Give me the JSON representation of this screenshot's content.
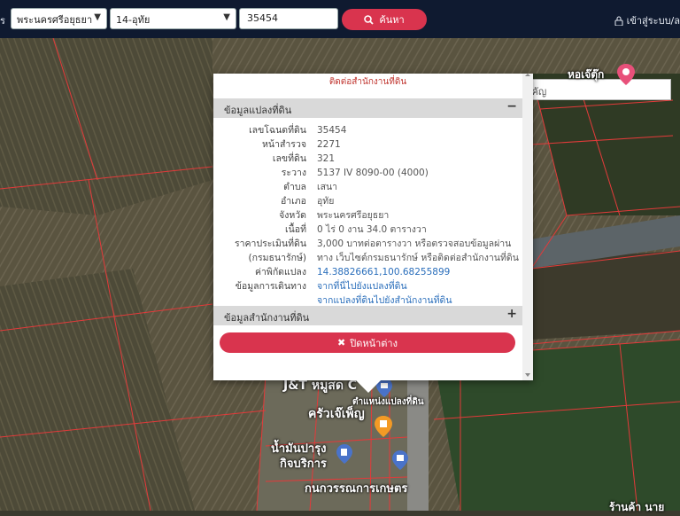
{
  "topbar": {
    "prov_label": "ร",
    "province": "พระนครศรีอยุธยา",
    "district": "14-อุทัย",
    "deed_no": "35454",
    "search_label": "ค้นหา",
    "login_label": "เข้าสู่ระบบ/ล"
  },
  "map": {
    "place_search_placeholder": "ค้นหาสถานที่สำคัญ",
    "labels": {
      "hor_jae_tuk": "หอเจ๊ตุ๊ก",
      "jt": "J&T หมูสด C",
      "parcel_pos": "ตำแหน่งแปลงที่ดิน",
      "krua": "ครัวเจ๊เพ็ญ",
      "oil1": "น้ำมันปารุง",
      "oil2": "กิจบริการ",
      "kanok": "กนกวรรณการเกษตร",
      "shop": "ร้านค้า นาย"
    }
  },
  "popup": {
    "top_link": "ติดต่อสำนักงานที่ดิน",
    "section1": "ข้อมูลแปลงที่ดิน",
    "section1_toggle": "−",
    "section2": "ข้อมูลสำนักงานที่ดิน",
    "section2_toggle": "+",
    "close_label": "ปิดหน้าต่าง",
    "rows": [
      {
        "k": "เลขโฉนดที่ดิน",
        "v": "35454"
      },
      {
        "k": "หน้าสำรวจ",
        "v": "2271"
      },
      {
        "k": "เลขที่ดิน",
        "v": "321"
      },
      {
        "k": "ระวาง",
        "v": "5137 IV 8090-00 (4000)"
      },
      {
        "k": "ตำบล",
        "v": "เสนา"
      },
      {
        "k": "อำเภอ",
        "v": "อุทัย"
      },
      {
        "k": "จังหวัด",
        "v": "พระนครศรีอยุธยา"
      },
      {
        "k": "เนื้อที่",
        "v": "0 ไร่ 0 งาน 34.0 ตารางวา"
      },
      {
        "k": "ราคาประเมินที่ดิน",
        "v": "3,000 บาทต่อตารางวา หรือตรวจสอบข้อมูลผ่าน"
      },
      {
        "k": "(กรมธนารักษ์)",
        "v": "ทาง เว็บไซต์กรมธนารักษ์ หรือติดต่อสำนักงานที่ดิน"
      },
      {
        "k": "ค่าพิกัดแปลง",
        "v": "14.38826661,100.68255899"
      },
      {
        "k": "ข้อมูลการเดินทาง",
        "v": "จากที่นี่ไปยังแปลงที่ดิน"
      },
      {
        "k": "",
        "v": "จากแปลงที่ดินไปยังสำนักงานที่ดิน"
      }
    ]
  }
}
